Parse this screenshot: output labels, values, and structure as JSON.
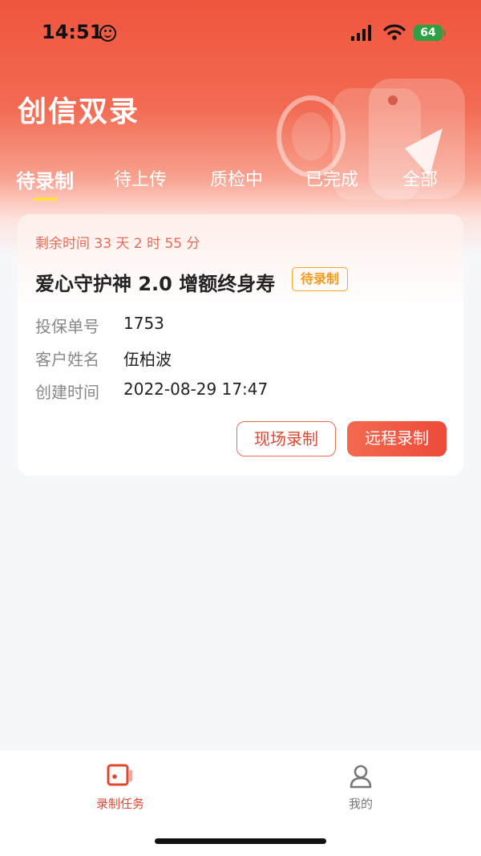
{
  "status_bar": {
    "time": "14:51",
    "battery": "64"
  },
  "app": {
    "title": "创信双录"
  },
  "tabs": [
    {
      "label": "待录制",
      "active": true
    },
    {
      "label": "待上传",
      "active": false
    },
    {
      "label": "质检中",
      "active": false
    },
    {
      "label": "已完成",
      "active": false
    },
    {
      "label": "全部",
      "active": false
    }
  ],
  "task_card": {
    "remaining_time": "剩余时间 33 天 2 时 55 分",
    "product_name": "爱心守护神 2.0 增额终身寿",
    "status": "待录制",
    "fields": [
      {
        "label": "投保单号",
        "value": "1753"
      },
      {
        "label": "客户姓名",
        "value": "伍柏波"
      },
      {
        "label": "创建时间",
        "value": "2022-08-29 17:47"
      }
    ],
    "buttons": {
      "onsite": "现场录制",
      "remote": "远程录制"
    }
  },
  "bottom_nav": [
    {
      "label": "录制任务",
      "icon": "video-record-icon",
      "active": true
    },
    {
      "label": "我的",
      "icon": "user-icon",
      "active": false
    }
  ],
  "colors": {
    "accent": "#ee4a3a",
    "badge": "#f5a623",
    "indicator": "#ffe13a"
  }
}
